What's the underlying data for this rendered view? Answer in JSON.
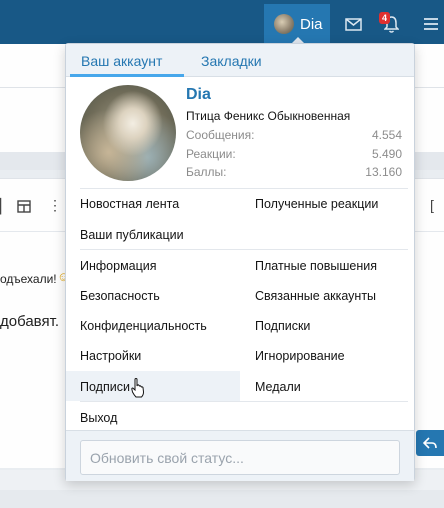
{
  "nav": {
    "username": "Dia",
    "alerts_count": "4",
    "icons": [
      "avatar",
      "mail-icon",
      "bell-icon",
      "menu-icon"
    ]
  },
  "background": {
    "text1": "одъехали!",
    "text2": "добавят."
  },
  "menu": {
    "tabs": [
      {
        "label": "Ваш аккаунт",
        "active": true
      },
      {
        "label": "Закладки",
        "active": false
      }
    ],
    "profile": {
      "name": "Dia",
      "title": "Птица Феникс Обыкновенная",
      "stats": [
        {
          "label": "Сообщения:",
          "value": "4.554"
        },
        {
          "label": "Реакции:",
          "value": "5.490"
        },
        {
          "label": "Баллы:",
          "value": "13.160"
        }
      ]
    },
    "group1": {
      "left": [
        "Новостная лента",
        "Ваши публикации"
      ],
      "right": [
        "Полученные реакции"
      ]
    },
    "group2": {
      "left": [
        "Информация",
        "Безопасность",
        "Конфиденциальность",
        "Настройки",
        "Подписи"
      ],
      "right": [
        "Платные повышения",
        "Связанные аккаунты",
        "Подписки",
        "Игнорирование",
        "Медали"
      ]
    },
    "logout": "Выход",
    "status_placeholder": "Обновить свой статус..."
  },
  "colors": {
    "nav_bg": "#185886",
    "accent": "#2577b1",
    "tab_underline": "#47a7eb",
    "badge": "#e03030"
  }
}
